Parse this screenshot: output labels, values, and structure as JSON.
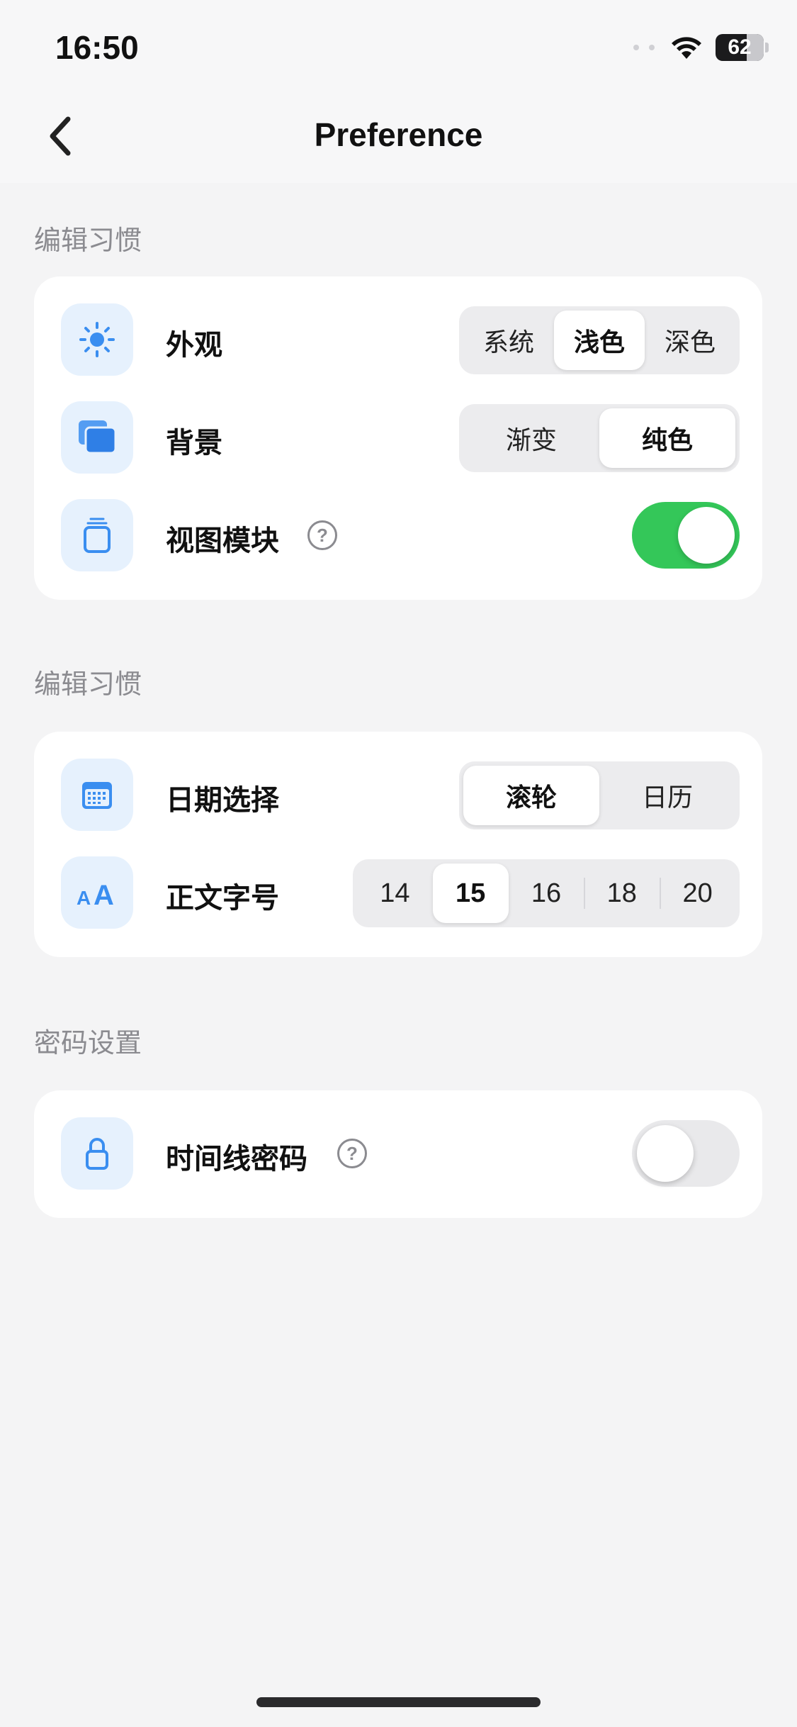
{
  "status": {
    "time": "16:50",
    "battery": "62"
  },
  "nav": {
    "title": "Preference"
  },
  "sections": [
    {
      "header": "编辑习惯"
    },
    {
      "header": "编辑习惯"
    },
    {
      "header": "密码设置"
    }
  ],
  "appearance": {
    "label": "外观",
    "options": [
      "系统",
      "浅色",
      "深色"
    ],
    "selected": "浅色"
  },
  "background": {
    "label": "背景",
    "options": [
      "渐变",
      "纯色"
    ],
    "selected": "纯色"
  },
  "view_module": {
    "label": "视图模块",
    "help": "?",
    "enabled": true
  },
  "date_picker": {
    "label": "日期选择",
    "options": [
      "滚轮",
      "日历"
    ],
    "selected": "滚轮"
  },
  "font_size": {
    "label": "正文字号",
    "options": [
      "14",
      "15",
      "16",
      "18",
      "20"
    ],
    "selected": "15"
  },
  "timeline_password": {
    "label": "时间线密码",
    "help": "?",
    "enabled": false
  },
  "icons": {
    "appearance": "sun-icon",
    "background": "stacked-cards-icon",
    "view_module": "stack-icon",
    "date_picker": "calendar-icon",
    "font_size": "text-size-icon",
    "timeline_password": "lock-icon"
  },
  "colors": {
    "accent": "#3a8ef0",
    "toggle_on": "#34c759",
    "icon_tile": "#e6f1fd"
  }
}
